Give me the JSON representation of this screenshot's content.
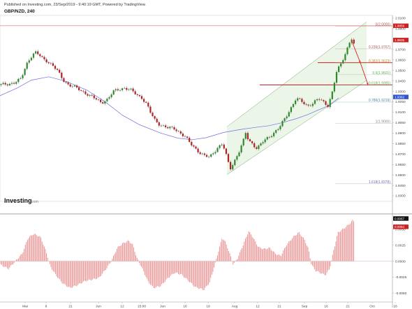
{
  "header": {
    "published": "Published on Investing.com, 23/Sep/2019 - 9:40:19 GMT, Powered by TradingView.",
    "symbol": "GBP/NZD, 240"
  },
  "branding": {
    "name": "Investing",
    "suffix": ".com"
  },
  "chart_data": [
    {
      "type": "candlestick",
      "title": "GBP/NZD, 240",
      "x_ticks": [
        "Mai",
        "8",
        "21",
        "Jun",
        "12",
        "15:00",
        "Jun",
        "16",
        "19",
        "Aug",
        "12",
        "21",
        "Sep",
        "16",
        "21",
        "Oct",
        "16"
      ],
      "y_ticks": [
        "2.0100",
        "1.9900",
        "1.9850",
        "1.9700",
        "1.9650",
        "1.9500",
        "1.9450",
        "1.9300",
        "1.9250",
        "1.9100",
        "1.9050",
        "1.8900",
        "1.8850",
        "1.8700",
        "1.8650",
        "1.8500",
        "1.8450",
        "1.8300"
      ],
      "ylim": [
        1.824,
        2.0112
      ],
      "moving_average": [
        [
          0,
          1.9285
        ],
        [
          25,
          1.9365
        ],
        [
          45,
          1.9445
        ],
        [
          70,
          1.948
        ],
        [
          95,
          1.9432
        ],
        [
          125,
          1.934
        ],
        [
          150,
          1.9225
        ],
        [
          175,
          1.9085
        ],
        [
          200,
          1.8985
        ],
        [
          230,
          1.89
        ],
        [
          255,
          1.8848
        ],
        [
          275,
          1.8832
        ],
        [
          295,
          1.8852
        ],
        [
          320,
          1.8906
        ],
        [
          345,
          1.8938
        ],
        [
          365,
          1.8958
        ],
        [
          385,
          1.8976
        ],
        [
          405,
          1.9008
        ],
        [
          425,
          1.905
        ],
        [
          440,
          1.9088
        ],
        [
          455,
          1.9135
        ],
        [
          470,
          1.918
        ],
        [
          485,
          1.9262
        ]
      ],
      "candles_path": [
        [
          0,
          1.9395
        ],
        [
          10,
          1.9405
        ],
        [
          20,
          1.9418
        ],
        [
          30,
          1.9455
        ],
        [
          38,
          1.9612
        ],
        [
          44,
          1.9685
        ],
        [
          50,
          1.9732
        ],
        [
          56,
          1.9702
        ],
        [
          62,
          1.9662
        ],
        [
          68,
          1.9642
        ],
        [
          75,
          1.9598
        ],
        [
          82,
          1.9542
        ],
        [
          90,
          1.9452
        ],
        [
          98,
          1.9398
        ],
        [
          106,
          1.9375
        ],
        [
          115,
          1.9342
        ],
        [
          125,
          1.9302
        ],
        [
          135,
          1.9258
        ],
        [
          145,
          1.9215
        ],
        [
          155,
          1.9252
        ],
        [
          162,
          1.9325
        ],
        [
          170,
          1.9352
        ],
        [
          178,
          1.9365
        ],
        [
          188,
          1.9338
        ],
        [
          196,
          1.9295
        ],
        [
          203,
          1.9265
        ],
        [
          210,
          1.9195
        ],
        [
          216,
          1.9102
        ],
        [
          222,
          1.9032
        ],
        [
          230,
          1.8982
        ],
        [
          240,
          1.8952
        ],
        [
          250,
          1.8948
        ],
        [
          258,
          1.8902
        ],
        [
          266,
          1.8852
        ],
        [
          272,
          1.8798
        ],
        [
          280,
          1.8742
        ],
        [
          286,
          1.8698
        ],
        [
          292,
          1.8665
        ],
        [
          300,
          1.8652
        ],
        [
          306,
          1.8705
        ],
        [
          312,
          1.8752
        ],
        [
          318,
          1.8785
        ],
        [
          322,
          1.8722
        ],
        [
          326,
          1.8612
        ],
        [
          330,
          1.8538
        ],
        [
          335,
          1.8605
        ],
        [
          342,
          1.8702
        ],
        [
          348,
          1.8805
        ],
        [
          352,
          1.8905
        ],
        [
          356,
          1.8822
        ],
        [
          360,
          1.8805
        ],
        [
          368,
          1.8738
        ],
        [
          376,
          1.8805
        ],
        [
          384,
          1.8858
        ],
        [
          392,
          1.8902
        ],
        [
          400,
          1.8952
        ],
        [
          408,
          1.9052
        ],
        [
          416,
          1.9152
        ],
        [
          424,
          1.9255
        ],
        [
          432,
          1.9225
        ],
        [
          440,
          1.9182
        ],
        [
          448,
          1.9205
        ],
        [
          456,
          1.9252
        ],
        [
          464,
          1.9218
        ],
        [
          470,
          1.9182
        ],
        [
          476,
          1.9325
        ],
        [
          482,
          1.9525
        ],
        [
          488,
          1.9612
        ],
        [
          494,
          1.9712
        ],
        [
          500,
          1.9825
        ],
        [
          503,
          1.9882
        ],
        [
          507,
          1.9805
        ]
      ],
      "channel": {
        "lower": [
          [
            325,
            1.8472
          ],
          [
            525,
            1.9442
          ]
        ],
        "upper": [
          [
            325,
            1.8965
          ],
          [
            525,
            2.0045
          ]
        ]
      },
      "fibonacci": [
        {
          "label": "0(2.0000)",
          "value": 2.0,
          "color": "#b06060"
        },
        {
          "label": "0.236(1.9767)",
          "value": 1.9767,
          "color": "#b06060"
        },
        {
          "label": "0.382(1.9623)",
          "value": 1.9623,
          "color": "#c08a3a"
        },
        {
          "label": "0.5(1.9501)",
          "value": 1.9501,
          "color": "#5aaa5a"
        },
        {
          "label": "0.618(1.9395)",
          "value": 1.9395,
          "color": "#5aaa5a"
        },
        {
          "label": "0.786(1.9219)",
          "value": 1.9219,
          "color": "#4a8a9a"
        },
        {
          "label": "1(1.9000)",
          "value": 1.9,
          "color": "#888888"
        },
        {
          "label": "1.618(1.8378)",
          "value": 1.8378,
          "color": "#7070b0"
        }
      ],
      "hlines": [
        {
          "value": 2.0005,
          "color": "#e07070"
        },
        {
          "value": 1.9625,
          "color": "#cc0000"
        },
        {
          "value": 1.9395,
          "color": "#cc0000"
        }
      ],
      "arrows": [
        {
          "from": [
            503,
            1.9862
          ],
          "to": [
            516,
            1.9625
          ]
        },
        {
          "from": [
            516,
            1.9625
          ],
          "to": [
            527,
            1.9398
          ]
        }
      ],
      "price_tags": [
        {
          "label": "1.9859",
          "value": 2.0005,
          "color": "#cc2222"
        },
        {
          "label": "1.9835",
          "value": 1.9858,
          "color": "#cc2222"
        },
        {
          "label": "1.9362",
          "value": 1.9272,
          "color": "#3355cc"
        }
      ]
    },
    {
      "type": "bar",
      "title": "",
      "y_ticks": [
        "0.0067",
        "0.0050",
        "0.0025",
        "0.0000",
        "-0.0025",
        "-0.0050"
      ],
      "ylim": [
        -0.0062,
        0.0072
      ],
      "values_path": [
        [
          0,
          -0.0005
        ],
        [
          12,
          -0.0012
        ],
        [
          22,
          0.0
        ],
        [
          32,
          0.0012
        ],
        [
          40,
          0.0036
        ],
        [
          48,
          0.0043
        ],
        [
          58,
          0.0038
        ],
        [
          66,
          0.0015
        ],
        [
          72,
          -0.0008
        ],
        [
          80,
          -0.0022
        ],
        [
          90,
          -0.0035
        ],
        [
          100,
          -0.0042
        ],
        [
          110,
          -0.0038
        ],
        [
          122,
          -0.0031
        ],
        [
          132,
          -0.0029
        ],
        [
          142,
          -0.0026
        ],
        [
          152,
          -0.0012
        ],
        [
          160,
          0.0001
        ],
        [
          168,
          0.0021
        ],
        [
          176,
          0.0028
        ],
        [
          184,
          0.0032
        ],
        [
          190,
          0.0026
        ],
        [
          196,
          0.0005
        ],
        [
          204,
          -0.0012
        ],
        [
          212,
          -0.0032
        ],
        [
          220,
          -0.0042
        ],
        [
          230,
          -0.0039
        ],
        [
          240,
          -0.0027
        ],
        [
          250,
          -0.0018
        ],
        [
          260,
          -0.0021
        ],
        [
          270,
          -0.0031
        ],
        [
          280,
          -0.0041
        ],
        [
          292,
          -0.0045
        ],
        [
          300,
          -0.0034
        ],
        [
          306,
          -0.0012
        ],
        [
          312,
          0.0012
        ],
        [
          318,
          0.0036
        ],
        [
          322,
          0.0032
        ],
        [
          328,
          0.0015
        ],
        [
          334,
          -0.0005
        ],
        [
          340,
          0.0004
        ],
        [
          348,
          0.0025
        ],
        [
          356,
          0.0047
        ],
        [
          362,
          0.0038
        ],
        [
          370,
          0.0022
        ],
        [
          378,
          0.0019
        ],
        [
          386,
          0.0021
        ],
        [
          394,
          0.0012
        ],
        [
          402,
          0.0008
        ],
        [
          410,
          0.0025
        ],
        [
          420,
          0.0038
        ],
        [
          428,
          0.0045
        ],
        [
          436,
          0.0034
        ],
        [
          442,
          0.0018
        ],
        [
          446,
          -0.0005
        ],
        [
          452,
          -0.0015
        ],
        [
          460,
          -0.0019
        ],
        [
          466,
          -0.0022
        ],
        [
          472,
          -0.0012
        ],
        [
          478,
          0.0018
        ],
        [
          484,
          0.0045
        ],
        [
          492,
          0.0051
        ],
        [
          500,
          0.0058
        ],
        [
          505,
          0.0064
        ],
        [
          508,
          0.0062
        ]
      ],
      "price_tags": [
        {
          "label": "0.0067",
          "value": 0.0067,
          "color": "#111111"
        },
        {
          "label": "0.0054",
          "value": 0.0054,
          "color": "#cc2222"
        }
      ]
    }
  ]
}
